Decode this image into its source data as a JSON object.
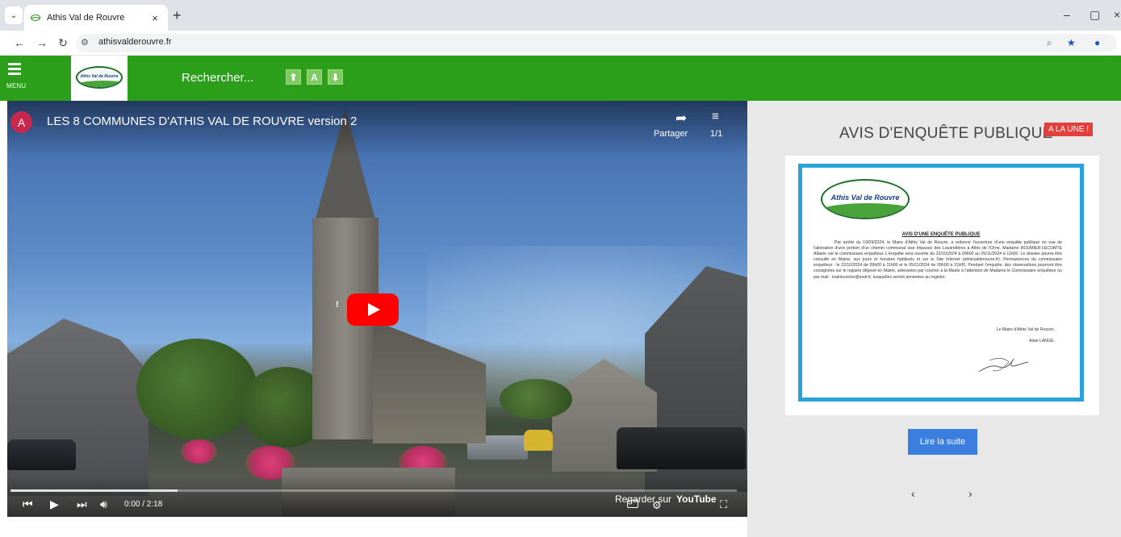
{
  "browser": {
    "tab_title": "Athis Val de Rouvre",
    "tab_close": "×",
    "new_tab": "+",
    "url": "athisvalderouvre.fr",
    "window_controls": {
      "minimize": "–",
      "maximize": "▢",
      "close": "×"
    }
  },
  "header": {
    "menu_label": "MENU",
    "logo_text": "Athis Val de Rouvre",
    "search_label": "Rechercher...",
    "text_size_buttons": {
      "increase": "⬆",
      "reset": "A",
      "decrease": "⬇"
    }
  },
  "video": {
    "channel_initial": "A",
    "title": "LES 8 COMMUNES D'ATHIS VAL DE ROUVRE version 2",
    "share_label": "Partager",
    "playlist_count": "1/1",
    "time": "0:00 / 2:18",
    "watch_on_label": "Regarder sur",
    "youtube_label": "YouTube",
    "progress_fraction": 0.23
  },
  "side": {
    "title": "AVIS D'ENQUÊTE PUBLIQUE",
    "badge": "A LA UNE !",
    "doc": {
      "logo_text": "Athis Val de Rouvre",
      "heading": "AVIS D'UNE ENQUÊTE PUBLIQUE",
      "body": "Par arrêté du 19/09/2024, le Maire d'Athis Val de Rouvre, a ordonné l'ouverture d'une enquête publique en vue de l'aliénation d'une portion d'un chemin communal sise Impasse des Lavandières à Athis de l'Orne. Madame ROUMIER-LECOMTE Albane est le commissaire enquêteur. L'enquête sera ouverte du 22/10/2024 à 09h00 au 05/11/2024 à 11h00. Le dossier pourra être consulté en Mairie, aux jours et horaires habituels et sur le Site Internet (athisvalderouvre.fr). Permanences du commissaire enquêteur : le 22/10/2024 de 09h00 à 11h00 et le 05/11/2024 de 09h00 à 11h00. Pendant l'enquête, des observations pourront être consignées sur le registre déposé en Mairie, adressées par courrier à la Mairie à l'attention de Madame le Commissaire enquêteur ou par mail : mairiecentre@avdr.fr; lesquelles seront annexées au registre.",
      "signature_line1": "Le Maire d'Athis Val de Rouvre,",
      "signature_line2": "Alain LANGE,"
    },
    "read_more": "Lire la suite",
    "prev": "‹",
    "next": "›"
  },
  "colors": {
    "header_green": "#2b9e1a",
    "badge_red": "#e2403c",
    "button_blue": "#3a7ee0",
    "doc_frame_blue": "#2aa3d8",
    "youtube_red": "#ff0000"
  }
}
